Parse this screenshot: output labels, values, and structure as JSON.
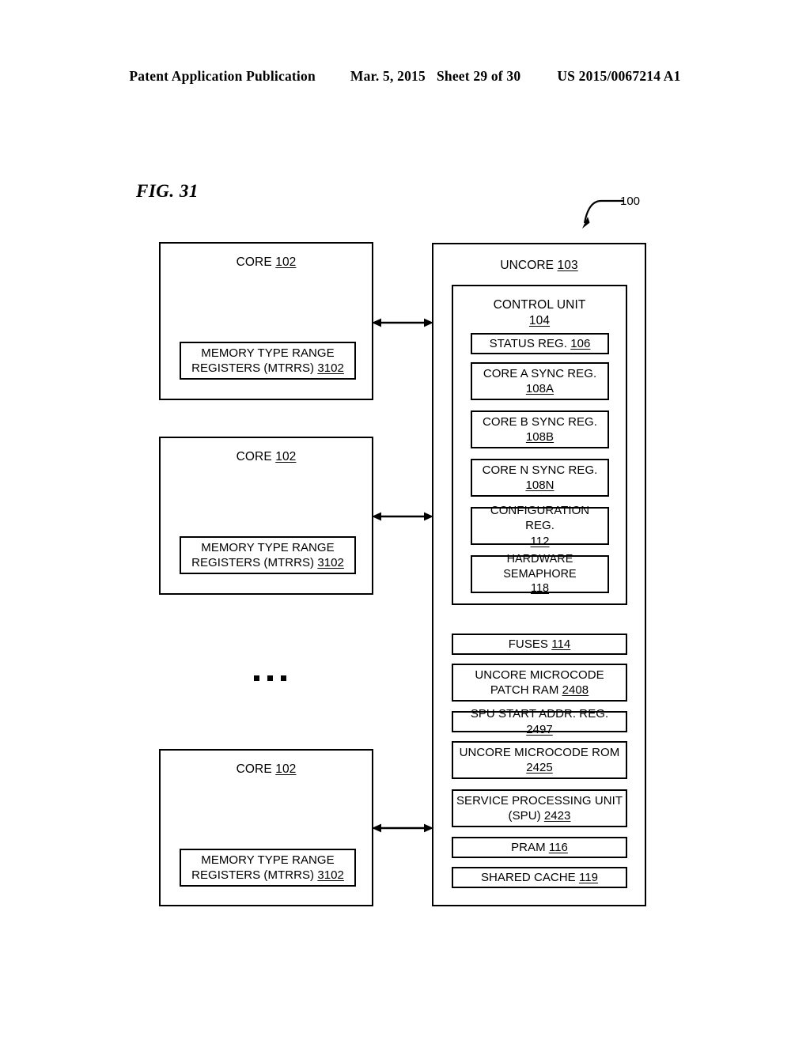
{
  "header": {
    "publication": "Patent Application Publication",
    "date": "Mar. 5, 2015",
    "sheet": "Sheet 29 of 30",
    "patent_number": "US 2015/0067214 A1"
  },
  "figure": {
    "label": "FIG. 31",
    "callout_ref": "100"
  },
  "cores": [
    {
      "title_text": "CORE",
      "title_ref": "102",
      "mtrr_line1": "MEMORY TYPE RANGE",
      "mtrr_line2": "REGISTERS (MTRRS)",
      "mtrr_ref": "3102"
    },
    {
      "title_text": "CORE",
      "title_ref": "102",
      "mtrr_line1": "MEMORY TYPE RANGE",
      "mtrr_line2": "REGISTERS (MTRRS)",
      "mtrr_ref": "3102"
    },
    {
      "title_text": "CORE",
      "title_ref": "102",
      "mtrr_line1": "MEMORY TYPE RANGE",
      "mtrr_line2": "REGISTERS (MTRRS)",
      "mtrr_ref": "3102"
    }
  ],
  "uncore": {
    "title_text": "UNCORE",
    "title_ref": "103",
    "control_unit": {
      "title_text": "CONTROL UNIT",
      "title_ref": "104",
      "registers": [
        {
          "line1": "STATUS REG.",
          "line2": "",
          "ref": "106",
          "inline_ref": true
        },
        {
          "line1": "CORE A SYNC REG.",
          "line2": "",
          "ref": "108A",
          "inline_ref": false
        },
        {
          "line1": "CORE B SYNC REG.",
          "line2": "",
          "ref": "108B",
          "inline_ref": false
        },
        {
          "line1": "CORE N SYNC REG.",
          "line2": "",
          "ref": "108N",
          "inline_ref": false
        },
        {
          "line1": "CONFIGURATION REG.",
          "line2": "",
          "ref": "112",
          "inline_ref": false
        },
        {
          "line1": "HARDWARE SEMAPHORE",
          "line2": "",
          "ref": "118",
          "inline_ref": false
        }
      ]
    },
    "blocks": [
      {
        "line1": "FUSES",
        "line2": "",
        "ref": "114",
        "inline_ref": true
      },
      {
        "line1": "UNCORE MICROCODE",
        "line2": "PATCH RAM",
        "ref": "2408",
        "inline_ref": true
      },
      {
        "line1": "SPU START ADDR. REG.",
        "line2": "",
        "ref": "2497",
        "inline_ref": true
      },
      {
        "line1": "UNCORE MICROCODE ROM",
        "line2": "",
        "ref": "2425",
        "inline_ref": false
      },
      {
        "line1": "SERVICE PROCESSING UNIT",
        "line2": "(SPU)",
        "ref": "2423",
        "inline_ref": true
      },
      {
        "line1": "PRAM",
        "line2": "",
        "ref": "116",
        "inline_ref": true
      },
      {
        "line1": "SHARED CACHE",
        "line2": "",
        "ref": "119",
        "inline_ref": true
      }
    ]
  },
  "ellipsis": "..."
}
